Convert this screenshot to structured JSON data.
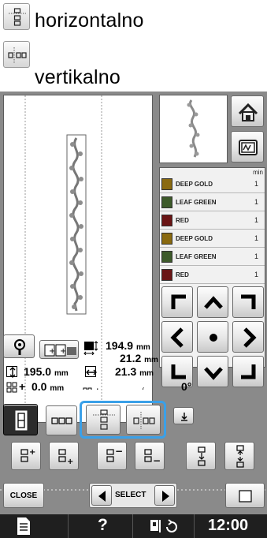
{
  "legend": {
    "horizontal_label": "horizontalno",
    "vertical_label": "vertikalno"
  },
  "thread_list": {
    "header": "min",
    "rows": [
      {
        "name": "DEEP GOLD",
        "count": "1",
        "color": "#8a6a10"
      },
      {
        "name": "LEAF GREEN",
        "count": "1",
        "color": "#3d5a2a"
      },
      {
        "name": "RED",
        "count": "1",
        "color": "#6a1414"
      },
      {
        "name": "DEEP GOLD",
        "count": "1",
        "color": "#8a6a10"
      },
      {
        "name": "LEAF GREEN",
        "count": "1",
        "color": "#3d5a2a"
      },
      {
        "name": "RED",
        "count": "1",
        "color": "#6a1414"
      }
    ]
  },
  "dimensions": {
    "height_value": "194.9",
    "height_unit": "mm",
    "width_value": "21.2",
    "width_unit": "mm",
    "total_height_value": "195.0",
    "total_height_unit": "mm",
    "total_width_value": "21.3",
    "total_width_unit": "mm",
    "spacing_value": "0.0",
    "spacing_unit": "mm",
    "angle_value": "0°"
  },
  "buttons": {
    "close_label": "CLOSE",
    "select_label": "SELECT"
  },
  "statusbar": {
    "help": "?",
    "time": "12:00"
  },
  "colors": {
    "highlight": "#3aa0e8",
    "screen_bg": "#8a8a8a",
    "statusbar_bg": "#1f1f1f"
  }
}
